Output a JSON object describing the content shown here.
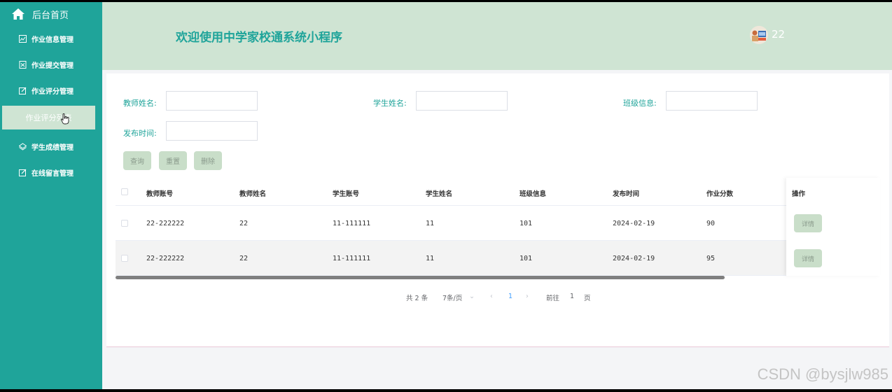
{
  "sidebar": {
    "home_label": "后台首页",
    "items": [
      {
        "label": "作业信息管理",
        "icon": "chart-icon"
      },
      {
        "label": "作业提交管理",
        "icon": "document-icon"
      },
      {
        "label": "作业评分管理",
        "icon": "edit-icon"
      },
      {
        "label": "学生成绩管理",
        "icon": "layers-icon"
      },
      {
        "label": "在线留言管理",
        "icon": "edit-icon"
      }
    ],
    "active_sub": "作业评分列表"
  },
  "header": {
    "title": "欢迎使用中学家校通系统小程序",
    "username": "22"
  },
  "search": {
    "teacher_name_label": "教师姓名:",
    "student_name_label": "学生姓名:",
    "class_label": "班级信息:",
    "publish_time_label": "发布时间:",
    "query_button": "查询",
    "reset_button": "重置",
    "delete_button": "删除"
  },
  "table": {
    "columns": [
      "教师账号",
      "教师姓名",
      "学生账号",
      "学生姓名",
      "班级信息",
      "发布时间",
      "作业分数",
      "操作"
    ],
    "rows": [
      {
        "teacher_account": "22-222222",
        "teacher_name": "22",
        "student_account": "11-111111",
        "student_name": "11",
        "class": "101",
        "publish_time": "2024-02-19",
        "score": "90",
        "action": "详情"
      },
      {
        "teacher_account": "22-222222",
        "teacher_name": "22",
        "student_account": "11-111111",
        "student_name": "11",
        "class": "101",
        "publish_time": "2024-02-19",
        "score": "95",
        "action": "详情"
      }
    ]
  },
  "pagination": {
    "total": "共 2 条",
    "page_size": "7条/页",
    "current_page": "1",
    "goto_label": "前往",
    "goto_value": "1",
    "page_suffix": "页"
  },
  "watermark": "CSDN @bysjlw985",
  "colors": {
    "sidebar": "#1fa49a",
    "header": "#cfe4d3",
    "button": "#c9dec9"
  }
}
